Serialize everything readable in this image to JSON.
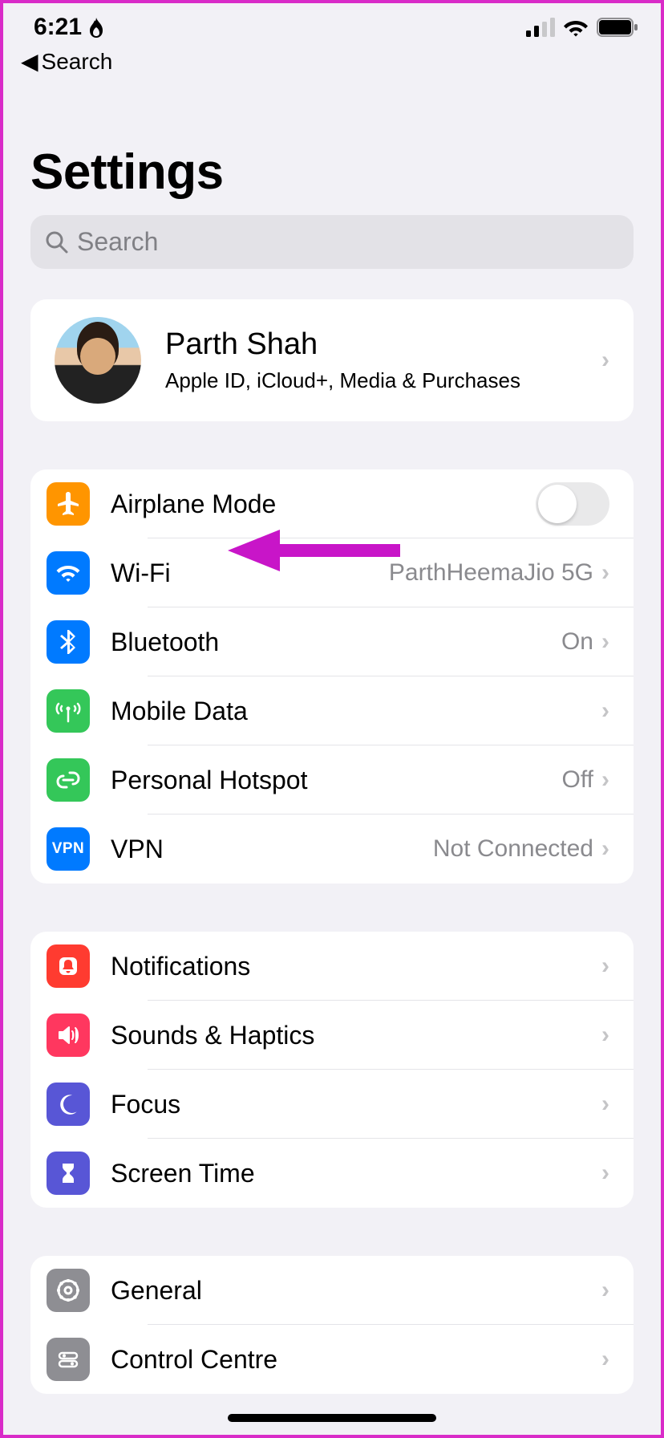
{
  "status": {
    "time": "6:21"
  },
  "back": {
    "label": "Search"
  },
  "title": "Settings",
  "search": {
    "placeholder": "Search"
  },
  "profile": {
    "name": "Parth Shah",
    "subtitle": "Apple ID, iCloud+, Media & Purchases"
  },
  "connectivity": {
    "airplane": {
      "label": "Airplane Mode"
    },
    "wifi": {
      "label": "Wi-Fi",
      "value": "ParthHeemaJio 5G"
    },
    "bluetooth": {
      "label": "Bluetooth",
      "value": "On"
    },
    "mobile": {
      "label": "Mobile Data"
    },
    "hotspot": {
      "label": "Personal Hotspot",
      "value": "Off"
    },
    "vpn": {
      "label": "VPN",
      "value": "Not Connected",
      "badge": "VPN"
    }
  },
  "notifications_group": {
    "notifications": {
      "label": "Notifications"
    },
    "sounds": {
      "label": "Sounds & Haptics"
    },
    "focus": {
      "label": "Focus"
    },
    "screentime": {
      "label": "Screen Time"
    }
  },
  "general_group": {
    "general": {
      "label": "General"
    },
    "control": {
      "label": "Control Centre"
    }
  }
}
